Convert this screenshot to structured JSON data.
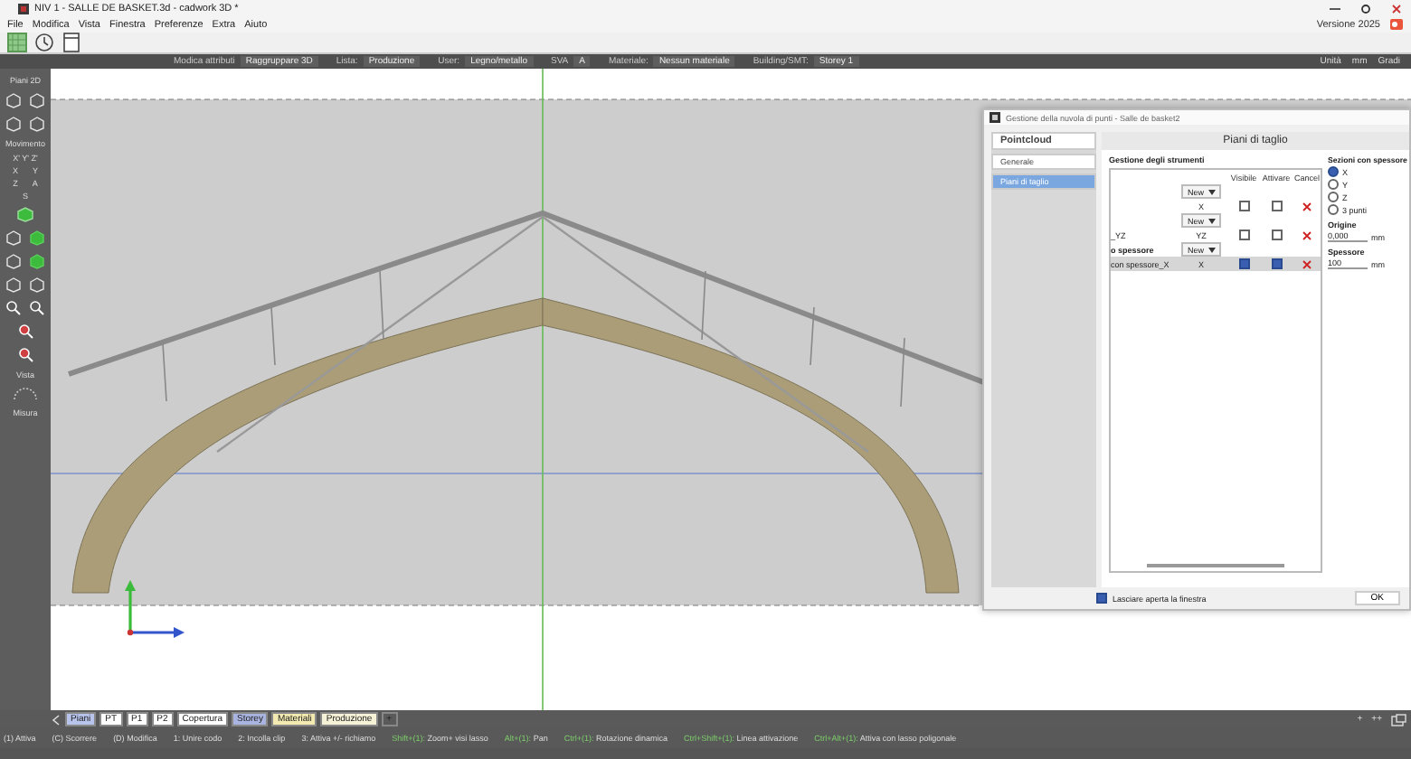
{
  "window": {
    "title": "NIV 1 - SALLE DE BASKET.3d - cadwork 3D *",
    "version": "Versione 2025"
  },
  "menu": [
    "File",
    "Modifica",
    "Vista",
    "Finestra",
    "Preferenze",
    "Extra",
    "Aiuto"
  ],
  "attribute_bar": [
    {
      "label": "Modica attributi",
      "value": "Raggruppare 3D"
    },
    {
      "label": "Lista:",
      "value": "Produzione"
    },
    {
      "label": "User:",
      "value": "Legno/metallo"
    },
    {
      "label": "SVA",
      "value": "A"
    },
    {
      "label": "Materiale:",
      "value": "Nessun materiale"
    },
    {
      "label": "Building/SMT:",
      "value": "Storey 1"
    }
  ],
  "units": [
    "Unità",
    "mm",
    "Gradi"
  ],
  "left_panel": {
    "sections": [
      {
        "title": "Piani 2D"
      },
      {
        "title": "Movimento",
        "keys": [
          [
            "X' Y' Z'"
          ],
          [
            "X",
            "Y"
          ],
          [
            "Z",
            "A"
          ],
          [
            "S"
          ]
        ]
      },
      {
        "title": "Vista"
      },
      {
        "title": "Misura"
      }
    ]
  },
  "dialog": {
    "title": "Gestione della nuvola di punti - Salle de basket2",
    "nav_header": "Pointcloud",
    "nav": [
      {
        "label": "Generale",
        "selected": false
      },
      {
        "label": "Piani di taglio",
        "selected": true
      }
    ],
    "header": "Piani di taglio",
    "section": "Gestione degli strumenti",
    "columns": [
      "Visibile",
      "Attivare",
      "Cancel"
    ],
    "rows": [
      {
        "kind": "group",
        "name": "",
        "value": "New",
        "selected": false
      },
      {
        "kind": "plane",
        "name": "",
        "type": "X",
        "visible": false,
        "active": false,
        "selected": false
      },
      {
        "kind": "group",
        "name": "",
        "value": "New",
        "selected": false
      },
      {
        "kind": "plane",
        "name": "_YZ",
        "type": "YZ",
        "visible": false,
        "active": false,
        "selected": false
      },
      {
        "kind": "group",
        "name": "o spessore",
        "value": "New",
        "selected": false
      },
      {
        "kind": "plane",
        "name": "con spessore_X",
        "type": "X",
        "visible": true,
        "active": true,
        "selected": true
      }
    ],
    "options_title": "Sezioni con spessore",
    "options": [
      {
        "label": "X",
        "selected": true
      },
      {
        "label": "Y",
        "selected": false
      },
      {
        "label": "Z",
        "selected": false
      },
      {
        "label": "3 punti",
        "selected": false
      }
    ],
    "fields": [
      {
        "label": "Origine",
        "value": "0,000",
        "unit": "mm"
      },
      {
        "label": "Spessore",
        "value": "100",
        "unit": "mm"
      }
    ],
    "keep_open": {
      "label": "Lasciare aperta la finestra",
      "checked": true
    },
    "ok": "OK"
  },
  "tabs": [
    {
      "label": "Piani",
      "color": "#b8c4ec"
    },
    {
      "label": "PT",
      "color": "#ffffff"
    },
    {
      "label": "P1",
      "color": "#ffffff"
    },
    {
      "label": "P2",
      "color": "#ffffff"
    },
    {
      "label": "Copertura",
      "color": "#ffffff"
    },
    {
      "label": "Storey",
      "color": "#a9b4e0"
    },
    {
      "label": "Materiali",
      "color": "#f2eab0"
    },
    {
      "label": "Produzione",
      "color": "#f6f2d8"
    },
    {
      "label": "+",
      "color": "#5a5a5a"
    }
  ],
  "zoom_buttons": [
    "+",
    "++"
  ],
  "status_bar": [
    {
      "kind": "plain",
      "key": "(1)",
      "label": "Attiva"
    },
    {
      "kind": "plain",
      "key": "(C)",
      "label": "Scorrere"
    },
    {
      "kind": "plain",
      "key": "(D)",
      "label": "Modifica"
    },
    {
      "kind": "plain",
      "key": "1:",
      "label": "Unire codo"
    },
    {
      "kind": "plain",
      "key": "2:",
      "label": "Incolla clip"
    },
    {
      "kind": "plain",
      "key": "3:",
      "label": "Attiva +/- richiamo"
    },
    {
      "kind": "combo",
      "key": "Shift+(1):",
      "label": "Zoom+ visi lasso"
    },
    {
      "kind": "combo",
      "key": "Alt+(1):",
      "label": "Pan"
    },
    {
      "kind": "combo",
      "key": "Ctrl+(1):",
      "label": "Rotazione dinamica"
    },
    {
      "kind": "combo",
      "key": "Ctrl+Shift+(1):",
      "label": "Linea attivazione"
    },
    {
      "kind": "combo",
      "key": "Ctrl+Alt+(1):",
      "label": "Attiva con lasso poligonale"
    }
  ]
}
